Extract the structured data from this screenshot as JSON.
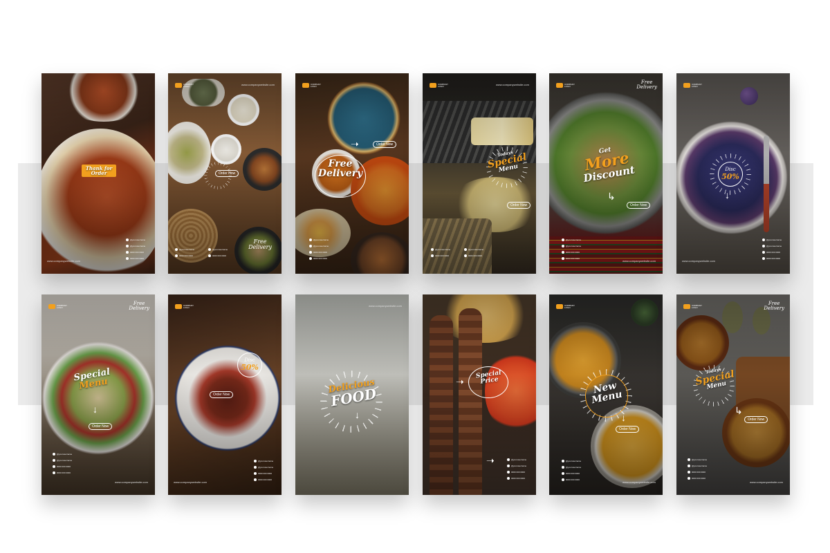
{
  "brand": {
    "logo_text": "COMPANY\nLOGO",
    "url": "www.companywebsite.com",
    "accent_color": "#f2a01e"
  },
  "contact_lines": [
    "@yourusername",
    "@yourusername",
    "0000 000 0000",
    "0000 000 0000"
  ],
  "cards": [
    {
      "headline_small": "Thank for",
      "headline_big": "Order",
      "order_label": "",
      "corner": ""
    },
    {
      "headline_small": "",
      "headline_big": "",
      "order_label": "Order Now",
      "corner": "Free\nDelivery"
    },
    {
      "headline_small": "Free",
      "headline_big": "Delivery",
      "order_label": "Order Now",
      "corner": ""
    },
    {
      "headline_small": "Todays",
      "headline_big": "Special",
      "headline_tail": "Menu",
      "order_label": "Order Now",
      "corner": ""
    },
    {
      "headline_small": "Get",
      "headline_big": "More",
      "headline_tail": "Discount",
      "order_label": "Order Now",
      "corner": "Free\nDelivery"
    },
    {
      "badge_small": "Disc",
      "badge_big": "50%",
      "order_label": "",
      "corner": ""
    },
    {
      "headline_small": "Special",
      "headline_big": "Menu",
      "order_label": "Order Now",
      "corner": "Free\nDelivery"
    },
    {
      "badge_small": "Disc",
      "badge_big": "50%",
      "order_label": "Order Now",
      "corner": ""
    },
    {
      "headline_small": "Delicious",
      "headline_big": "FOOD",
      "order_label": "",
      "corner": ""
    },
    {
      "headline_small": "Special Price",
      "headline_big": "",
      "order_label": "",
      "corner": ""
    },
    {
      "headline_small": "New",
      "headline_big": "Menu",
      "order_label": "Order Now",
      "corner": ""
    },
    {
      "headline_small": "Todays",
      "headline_big": "Special",
      "headline_tail": "Menu",
      "order_label": "Order Now",
      "corner": "Free\nDelivery"
    }
  ]
}
